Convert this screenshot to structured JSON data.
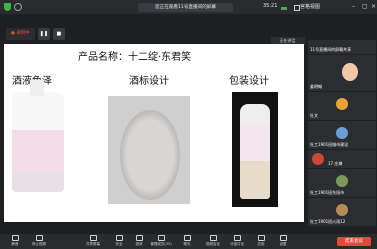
{
  "title_bar": {
    "title": "您正在观看11号直播间的屏幕",
    "time": "35:21",
    "gallery_label": "宫格视图"
  },
  "share_controls": {
    "recording_label": "录制中",
    "end_label": "结束观看",
    "status_note": "正在讲话:"
  },
  "slide": {
    "product_title": "产品名称：十二绽·东君笑",
    "sections": [
      "酒液色泽",
      "酒标设计",
      "包装设计"
    ]
  },
  "participants": [
    {
      "name": "11号直播间的屏幕共享"
    },
    {
      "name": "姜明翰"
    },
    {
      "name": "杜文"
    },
    {
      "name": "杜工1901班城市建设"
    },
    {
      "name": "17 庄琳"
    },
    {
      "name": "杜工1901班东阳市"
    },
    {
      "name": "杜工1901班火雨12"
    }
  ],
  "toolbar": {
    "items": [
      "静音",
      "停止视频",
      "共享屏幕",
      "安全",
      "邀请",
      "管理成员(35)",
      "聊天",
      "视频会议",
      "分组讨论",
      "应用",
      "设置"
    ],
    "end_meeting": "结束会议"
  }
}
